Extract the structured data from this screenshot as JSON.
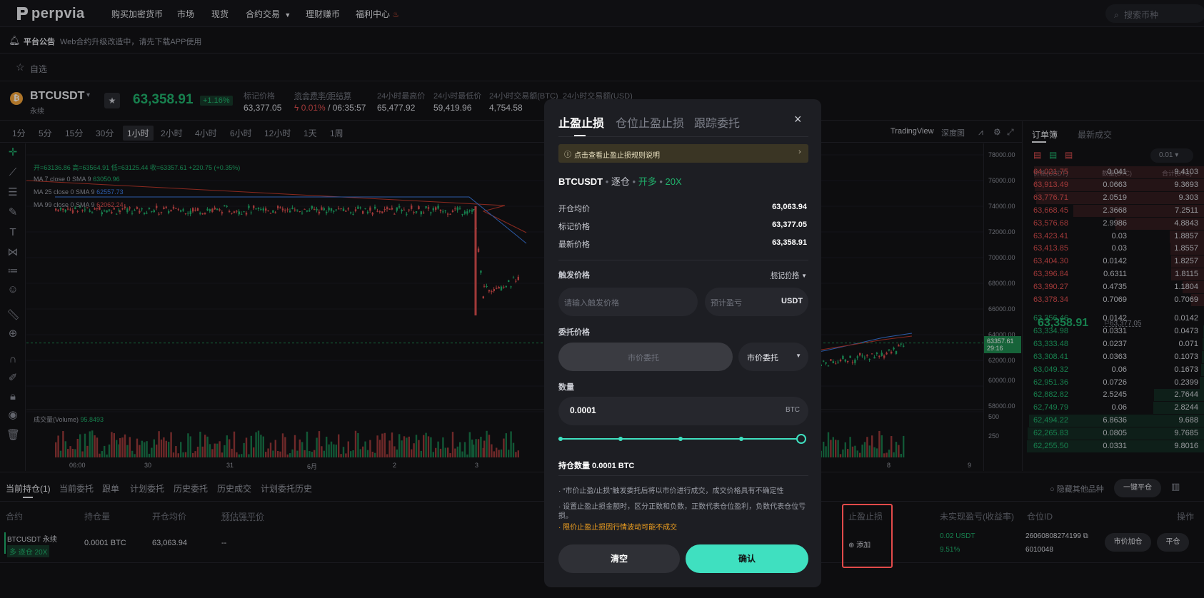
{
  "brand": {
    "name": "perpvia"
  },
  "nav": {
    "items": [
      "购买加密货币",
      "市场",
      "现货",
      "合约交易",
      "理财赚币",
      "福利中心"
    ],
    "search_placeholder": "搜索币种"
  },
  "notice": {
    "title": "平台公告",
    "text": "Web合约升级改造中，请先下载APP使用"
  },
  "favorites": {
    "label": "自选"
  },
  "ticker": {
    "symbol": "BTCUSDT",
    "sub": "永续",
    "price": "63,358.91",
    "change": "+1.16%",
    "stats": [
      {
        "label": "标记价格",
        "value": "63,377.05"
      },
      {
        "label": "资金费率/距结算",
        "value": "0.01% / 06:35:57"
      },
      {
        "label": "24小时最高价",
        "value": "65,477.92"
      },
      {
        "label": "24小时最低价",
        "value": "59,419.96"
      },
      {
        "label": "24小时交易额(BTC)",
        "value": "4,754.58"
      },
      {
        "label": "24小时交易额(USD)",
        "value": ""
      }
    ]
  },
  "chart": {
    "intervals": [
      "1分",
      "5分",
      "15分",
      "30分",
      "1小时",
      "2小时",
      "4小时",
      "6小时",
      "12小时",
      "1天",
      "1周"
    ],
    "active_interval": "1小时",
    "views": [
      "TradingView",
      "深度图"
    ],
    "ohlc_line": "开=63136.86 高=63564.91 低=63125.44 收=63357.61 +220.75 (+0.35%)",
    "ma_lines": [
      {
        "label": "MA 7 close 0 SMA 9",
        "value": "63050.96",
        "color": "#c9a227"
      },
      {
        "label": "MA 25 close 0 SMA 9",
        "value": "62557.73",
        "color": "#3d7ee8"
      },
      {
        "label": "MA 99 close 0 SMA 9",
        "value": "62062.24",
        "color": "#c0392b"
      }
    ],
    "volume_label": "成交量(Volume)",
    "volume_value": "95.8493",
    "price_ticks": [
      "78000.00",
      "76000.00",
      "74000.00",
      "72000.00",
      "70000.00",
      "68000.00",
      "66000.00",
      "64000.00",
      "62000.00",
      "60000.00",
      "58000.00"
    ],
    "volume_ticks": [
      "500",
      "250"
    ],
    "current_price_tag": "63357.61",
    "countdown_tag": "29:16",
    "time_ticks": [
      "06:00",
      "30",
      "31",
      "6月",
      "2",
      "3",
      "8",
      "9"
    ]
  },
  "orderbook": {
    "tabs": [
      "订单簿",
      "最新成交"
    ],
    "precision": "0.01",
    "headers": [
      "价格(USDT)",
      "数量(BTC)",
      "合计(BTC)"
    ],
    "asks": [
      [
        "64,021.75",
        "0.041",
        "9.4103"
      ],
      [
        "63,913.49",
        "0.0663",
        "9.3693"
      ],
      [
        "63,776.71",
        "2.0519",
        "9.303"
      ],
      [
        "63,668.45",
        "2.3668",
        "7.2511"
      ],
      [
        "63,576.68",
        "2.9986",
        "4.8843"
      ],
      [
        "63,423.41",
        "0.03",
        "1.8857"
      ],
      [
        "63,413.85",
        "0.03",
        "1.8557"
      ],
      [
        "63,404.30",
        "0.0142",
        "1.8257"
      ],
      [
        "63,396.84",
        "0.6311",
        "1.8115"
      ],
      [
        "63,390.27",
        "0.4735",
        "1.1804"
      ],
      [
        "63,378.34",
        "0.7069",
        "0.7069"
      ]
    ],
    "mid_price": "63,358.91",
    "mid_mark": "63,377.05",
    "bids": [
      [
        "63,356.46",
        "0.0142",
        "0.0142"
      ],
      [
        "63,334.98",
        "0.0331",
        "0.0473"
      ],
      [
        "63,333.48",
        "0.0237",
        "0.071"
      ],
      [
        "63,308.41",
        "0.0363",
        "0.1073"
      ],
      [
        "63,049.32",
        "0.06",
        "0.1673"
      ],
      [
        "62,951.36",
        "0.0726",
        "0.2399"
      ],
      [
        "62,882.82",
        "2.5245",
        "2.7644"
      ],
      [
        "62,749.79",
        "0.06",
        "2.8244"
      ],
      [
        "62,494.22",
        "6.8636",
        "9.688"
      ],
      [
        "62,265.83",
        "0.0805",
        "9.7685"
      ],
      [
        "62,255.50",
        "0.0331",
        "9.8016"
      ]
    ]
  },
  "positions": {
    "tabs": [
      "当前持仓(1)",
      "当前委托",
      "跟单",
      "计划委托",
      "历史委托",
      "历史成交",
      "计划委托历史"
    ],
    "hide_others": "隐藏其他品种",
    "close_all": "一键平仓",
    "headers": [
      "合约",
      "持仓量",
      "开仓均价",
      "预估强平价",
      "止盈止损",
      "未实现盈亏(收益率)",
      "仓位ID",
      "操作"
    ],
    "row": {
      "symbol": "BTCUSDT 永续",
      "tag": "多 逐仓 20X",
      "size": "0.0001 BTC",
      "entry": "63,063.94",
      "liq": "--",
      "tpsl_add": "添加",
      "pnl": "0.02 USDT",
      "pnl_pct": "9.51%",
      "position_id_1": "26060808274199",
      "position_id_2": "6010048",
      "btn_market_add": "市价加仓",
      "btn_close": "平仓"
    }
  },
  "modal": {
    "tabs": [
      "止盈止损",
      "仓位止盈止损",
      "跟踪委托"
    ],
    "info_banner": "点击查看止盈止损规则说明",
    "pair": "BTCUSDT",
    "margin_mode": "逐仓",
    "direction": "开多",
    "leverage": "20X",
    "rows": [
      {
        "label": "开仓均价",
        "value": "63,063.94"
      },
      {
        "label": "标记价格",
        "value": "63,377.05"
      },
      {
        "label": "最新价格",
        "value": "63,358.91"
      }
    ],
    "trigger_label": "触发价格",
    "trigger_type": "标记价格",
    "trigger_placeholder": "请输入触发价格",
    "pnl_placeholder": "预计盈亏",
    "pnl_unit": "USDT",
    "order_price_label": "委托价格",
    "order_price_placeholder": "市价委托",
    "order_type": "市价委托",
    "qty_label": "数量",
    "qty_value": "0.0001",
    "qty_unit": "BTC",
    "slider_percent": 100,
    "hold_label": "持仓数量 0.0001 BTC",
    "notes": [
      "“市价止盈/止损”触发委托后将以市价进行成交，成交价格具有不确定性",
      "设置止盈止损金额时，区分正数和负数，正数代表仓位盈利，负数代表仓位亏损。"
    ],
    "warning": "限价止盈止损因行情波动可能不成交",
    "btn_clear": "清空",
    "btn_confirm": "确认"
  },
  "colors": {
    "accent": "#3fe0c0",
    "up": "#20b26c",
    "down": "#e04f4f",
    "warning": "#f0a020"
  }
}
